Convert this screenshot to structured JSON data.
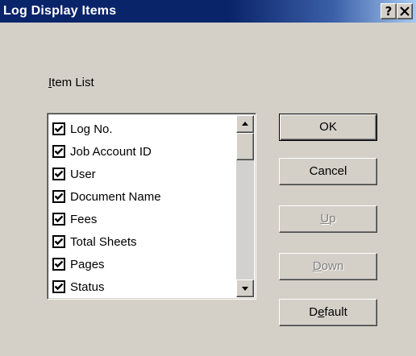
{
  "window": {
    "title": "Log Display Items",
    "help_label": "?",
    "close_icon": "close-icon"
  },
  "item_list": {
    "label": "Item List",
    "label_accel": "I",
    "label_rest": "tem List",
    "items": [
      {
        "label": "Log No.",
        "checked": true
      },
      {
        "label": "Job Account ID",
        "checked": true
      },
      {
        "label": "User",
        "checked": true
      },
      {
        "label": "Document Name",
        "checked": true
      },
      {
        "label": "Fees",
        "checked": true
      },
      {
        "label": "Total Sheets",
        "checked": true
      },
      {
        "label": "Pages",
        "checked": true
      },
      {
        "label": "Status",
        "checked": true
      }
    ]
  },
  "buttons": {
    "ok": {
      "label": "OK",
      "enabled": true,
      "is_default": true
    },
    "cancel": {
      "label": "Cancel",
      "enabled": true
    },
    "up": {
      "label": "Up",
      "accel": "U",
      "rest": "p",
      "enabled": false
    },
    "down": {
      "label": "Down",
      "accel": "D",
      "rest": "own",
      "enabled": false
    },
    "default": {
      "label": "Default",
      "pre": "D",
      "accel": "e",
      "rest": "fault",
      "enabled": true
    }
  },
  "colors": {
    "titlebar_start": "#0a246a",
    "titlebar_end": "#a6caf0",
    "face": "#d4d0c8",
    "disabled_text": "#808080"
  }
}
